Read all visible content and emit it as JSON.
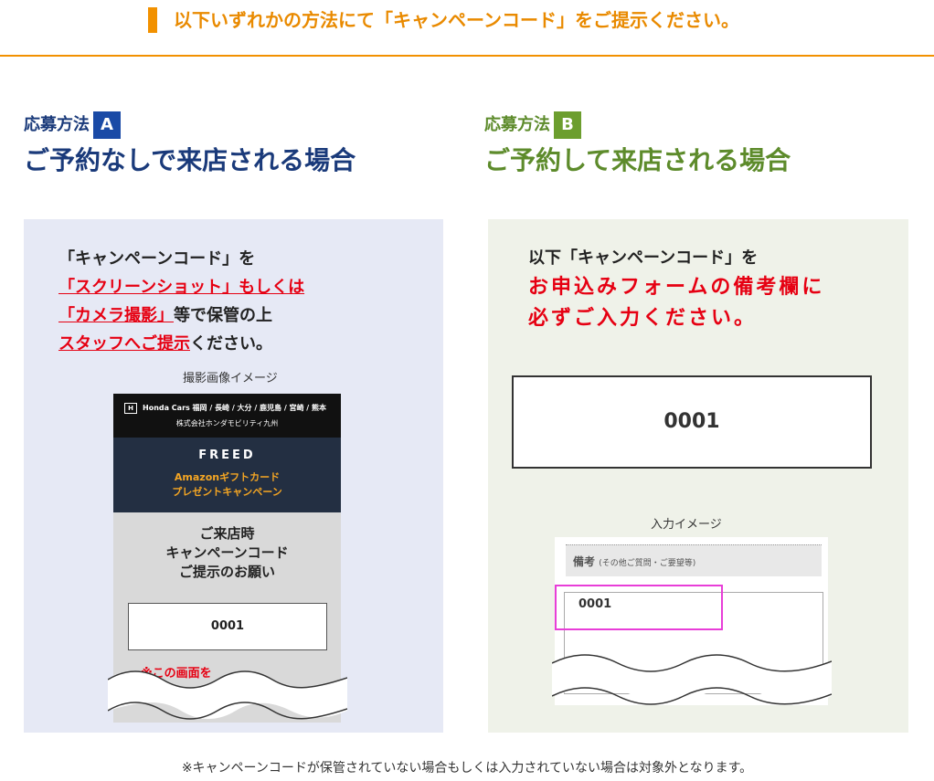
{
  "header": {
    "title": "以下いずれかの方法にて「キャンペーンコード」をご提示ください。"
  },
  "methodA": {
    "label": "応募方法",
    "badge": "A",
    "title": "ご予約なしで来店される場合",
    "text_line1": "「キャンペーンコード」を",
    "text_line2": "「スクリーンショット」もしくは",
    "text_line3_red": "「カメラ撮影」",
    "text_line3_rest": "等で保管の上",
    "text_line4_red": "スタッフへご提示",
    "text_line4_rest": "ください。",
    "caption": "撮影画像イメージ",
    "phone": {
      "brand": "Honda Cars 福岡 / 長崎 / 大分 / 鹿児島 / 宮崎 / 熊本",
      "corp": "株式会社ホンダモビリティ九州",
      "model": "FREED",
      "promo_line1": "Amazonギフトカード",
      "promo_line2": "プレゼントキャンペーン",
      "msg_line1": "ご来店時",
      "msg_line2": "キャンペーンコード",
      "msg_line3": "ご提示のお願い",
      "code": "0001",
      "cut_text": "※この画面を"
    }
  },
  "methodB": {
    "label": "応募方法",
    "badge": "B",
    "title": "ご予約して来店される場合",
    "text_line1": "以下「キャンペーンコード」を",
    "text_line2": "お申込みフォームの備考欄に",
    "text_line3": "必ずご入力ください。",
    "code": "0001",
    "caption": "入力イメージ",
    "form": {
      "label": "備考",
      "label_note": "(その他ご質問・ご要望等)",
      "value": "0001"
    }
  },
  "footer": {
    "note": "※キャンペーンコードが保管されていない場合もしくは入力されていない場合は対象外となります。"
  },
  "colors": {
    "orange": "#f29100",
    "blueA": "#1a4aa6",
    "greenB": "#6c9e2e",
    "red": "#e60012",
    "highlight": "#e83ed8"
  }
}
